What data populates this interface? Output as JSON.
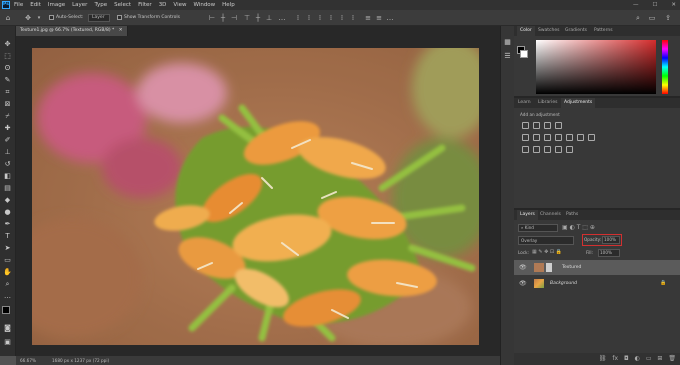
{
  "app": {
    "logo": "Ps"
  },
  "menubar": {
    "items": [
      "File",
      "Edit",
      "Image",
      "Layer",
      "Type",
      "Select",
      "Filter",
      "3D",
      "View",
      "Window",
      "Help"
    ],
    "window_controls": [
      "—",
      "☐",
      "✕"
    ]
  },
  "options": {
    "auto_select_label": "Auto-Select:",
    "auto_select_target": "Layer",
    "transform_label": "Show Transform Controls"
  },
  "document": {
    "tab_title": "Texture1.jpg @ 66.7% (Textured, RGB/8) *",
    "zoom": "66.67%",
    "info": "1680 px x 1237 px (72 ppi)"
  },
  "color_panel": {
    "tabs": [
      "Color",
      "Swatches",
      "Gradients",
      "Patterns"
    ],
    "hue_color": "#d42c2c"
  },
  "adjustments_panel": {
    "tabs": [
      "Learn",
      "Libraries",
      "Adjustments"
    ],
    "title": "Add an adjustment"
  },
  "layers_panel": {
    "tabs": [
      "Layers",
      "Channels",
      "Paths"
    ],
    "kind_filter": "Kind",
    "blend_mode": "Overlay",
    "opacity_label": "Opacity:",
    "opacity_value": "100%",
    "lock_label": "Lock:",
    "fill_label": "Fill:",
    "fill_value": "100%",
    "layers": [
      {
        "name": "Textured",
        "italic": false,
        "selected": true
      },
      {
        "name": "Background",
        "italic": true,
        "selected": false
      }
    ]
  },
  "colors": {
    "accent": "#31a8ff",
    "highlight_box": "#d23030"
  }
}
